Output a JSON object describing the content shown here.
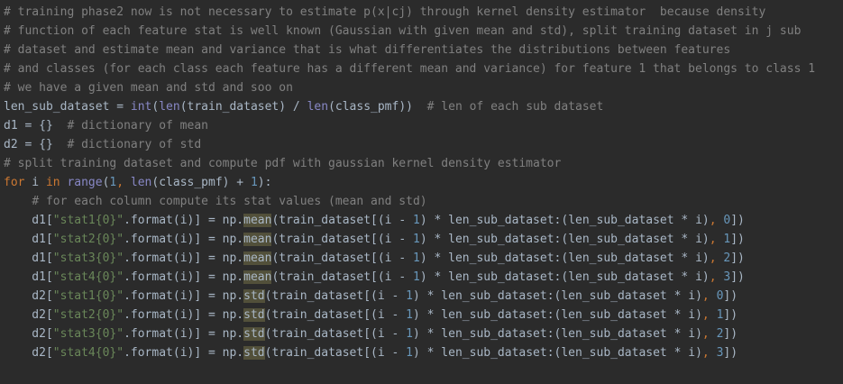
{
  "editor": {
    "theme_colors": {
      "background": "#2b2b2b",
      "default_text": "#a9b7c6",
      "comment": "#808080",
      "keyword": "#cc7832",
      "builtin": "#8888c6",
      "string": "#6a8759",
      "number": "#6897bb",
      "identifier_highlight": "#52503a"
    },
    "lines": [
      [
        {
          "t": "comment",
          "v": "# training phase2 now is not necessary to estimate p(x|cj) through kernel density estimator  because density"
        }
      ],
      [
        {
          "t": "comment",
          "v": "# function of each feature stat is well known (Gaussian with given mean and std), split training dataset in j sub"
        }
      ],
      [
        {
          "t": "comment",
          "v": "# dataset and estimate mean and variance that is what differentiates the distributions between features"
        }
      ],
      [
        {
          "t": "comment",
          "v": "# and classes (for each class each feature has a different mean and variance) for feature 1 that belongs to class 1"
        }
      ],
      [
        {
          "t": "comment",
          "v": "# we have a given mean and std and soo on"
        }
      ],
      [
        {
          "t": "plain",
          "v": "len_sub_dataset = "
        },
        {
          "t": "builtin",
          "v": "int"
        },
        {
          "t": "plain",
          "v": "("
        },
        {
          "t": "builtin",
          "v": "len"
        },
        {
          "t": "plain",
          "v": "(train_dataset) / "
        },
        {
          "t": "builtin",
          "v": "len"
        },
        {
          "t": "plain",
          "v": "(class_pmf))  "
        },
        {
          "t": "comment",
          "v": "# len of each sub dataset"
        }
      ],
      [
        {
          "t": "plain",
          "v": "d1 = {}  "
        },
        {
          "t": "comment",
          "v": "# dictionary of mean"
        }
      ],
      [
        {
          "t": "plain",
          "v": "d2 = {}  "
        },
        {
          "t": "comment",
          "v": "# dictionary of std"
        }
      ],
      [
        {
          "t": "comment",
          "v": "# split training dataset and compute pdf with gaussian kernel density estimator"
        }
      ],
      [
        {
          "t": "keyword",
          "v": "for"
        },
        {
          "t": "plain",
          "v": " i "
        },
        {
          "t": "keyword",
          "v": "in"
        },
        {
          "t": "plain",
          "v": " "
        },
        {
          "t": "builtin",
          "v": "range"
        },
        {
          "t": "plain",
          "v": "("
        },
        {
          "t": "number",
          "v": "1"
        },
        {
          "t": "keyword",
          "v": ","
        },
        {
          "t": "plain",
          "v": " "
        },
        {
          "t": "builtin",
          "v": "len"
        },
        {
          "t": "plain",
          "v": "(class_pmf) + "
        },
        {
          "t": "number",
          "v": "1"
        },
        {
          "t": "plain",
          "v": "):"
        }
      ],
      [
        {
          "t": "plain",
          "v": "    "
        },
        {
          "t": "comment",
          "v": "# for each column compute its stat values (mean and std)"
        }
      ],
      [
        {
          "t": "plain",
          "v": "    d1["
        },
        {
          "t": "string",
          "v": "\"stat1{0}\""
        },
        {
          "t": "plain",
          "v": ".format(i)] = np."
        },
        {
          "t": "hl",
          "v": "mean"
        },
        {
          "t": "plain",
          "v": "(train_dataset[(i - "
        },
        {
          "t": "number",
          "v": "1"
        },
        {
          "t": "plain",
          "v": ") * len_sub_dataset:(len_sub_dataset * i)"
        },
        {
          "t": "keyword",
          "v": ","
        },
        {
          "t": "plain",
          "v": " "
        },
        {
          "t": "number",
          "v": "0"
        },
        {
          "t": "plain",
          "v": "])"
        }
      ],
      [
        {
          "t": "plain",
          "v": "    d1["
        },
        {
          "t": "string",
          "v": "\"stat2{0}\""
        },
        {
          "t": "plain",
          "v": ".format(i)] = np."
        },
        {
          "t": "hl",
          "v": "mean"
        },
        {
          "t": "plain",
          "v": "(train_dataset[(i - "
        },
        {
          "t": "number",
          "v": "1"
        },
        {
          "t": "plain",
          "v": ") * len_sub_dataset:(len_sub_dataset * i)"
        },
        {
          "t": "keyword",
          "v": ","
        },
        {
          "t": "plain",
          "v": " "
        },
        {
          "t": "number",
          "v": "1"
        },
        {
          "t": "plain",
          "v": "])"
        }
      ],
      [
        {
          "t": "plain",
          "v": "    d1["
        },
        {
          "t": "string",
          "v": "\"stat3{0}\""
        },
        {
          "t": "plain",
          "v": ".format(i)] = np."
        },
        {
          "t": "hl",
          "v": "mean"
        },
        {
          "t": "plain",
          "v": "(train_dataset[(i - "
        },
        {
          "t": "number",
          "v": "1"
        },
        {
          "t": "plain",
          "v": ") * len_sub_dataset:(len_sub_dataset * i)"
        },
        {
          "t": "keyword",
          "v": ","
        },
        {
          "t": "plain",
          "v": " "
        },
        {
          "t": "number",
          "v": "2"
        },
        {
          "t": "plain",
          "v": "])"
        }
      ],
      [
        {
          "t": "plain",
          "v": "    d1["
        },
        {
          "t": "string",
          "v": "\"stat4{0}\""
        },
        {
          "t": "plain",
          "v": ".format(i)] = np."
        },
        {
          "t": "hl",
          "v": "mean"
        },
        {
          "t": "plain",
          "v": "(train_dataset[(i - "
        },
        {
          "t": "number",
          "v": "1"
        },
        {
          "t": "plain",
          "v": ") * len_sub_dataset:(len_sub_dataset * i)"
        },
        {
          "t": "keyword",
          "v": ","
        },
        {
          "t": "plain",
          "v": " "
        },
        {
          "t": "number",
          "v": "3"
        },
        {
          "t": "plain",
          "v": "])"
        }
      ],
      [
        {
          "t": "plain",
          "v": "    d2["
        },
        {
          "t": "string",
          "v": "\"stat1{0}\""
        },
        {
          "t": "plain",
          "v": ".format(i)] = np."
        },
        {
          "t": "hl",
          "v": "std"
        },
        {
          "t": "plain",
          "v": "(train_dataset[(i - "
        },
        {
          "t": "number",
          "v": "1"
        },
        {
          "t": "plain",
          "v": ") * len_sub_dataset:(len_sub_dataset * i)"
        },
        {
          "t": "keyword",
          "v": ","
        },
        {
          "t": "plain",
          "v": " "
        },
        {
          "t": "number",
          "v": "0"
        },
        {
          "t": "plain",
          "v": "])"
        }
      ],
      [
        {
          "t": "plain",
          "v": "    d2["
        },
        {
          "t": "string",
          "v": "\"stat2{0}\""
        },
        {
          "t": "plain",
          "v": ".format(i)] = np."
        },
        {
          "t": "hl",
          "v": "std"
        },
        {
          "t": "plain",
          "v": "(train_dataset[(i - "
        },
        {
          "t": "number",
          "v": "1"
        },
        {
          "t": "plain",
          "v": ") * len_sub_dataset:(len_sub_dataset * i)"
        },
        {
          "t": "keyword",
          "v": ","
        },
        {
          "t": "plain",
          "v": " "
        },
        {
          "t": "number",
          "v": "1"
        },
        {
          "t": "plain",
          "v": "])"
        }
      ],
      [
        {
          "t": "plain",
          "v": "    d2["
        },
        {
          "t": "string",
          "v": "\"stat3{0}\""
        },
        {
          "t": "plain",
          "v": ".format(i)] = np."
        },
        {
          "t": "hl",
          "v": "std"
        },
        {
          "t": "plain",
          "v": "(train_dataset[(i - "
        },
        {
          "t": "number",
          "v": "1"
        },
        {
          "t": "plain",
          "v": ") * len_sub_dataset:(len_sub_dataset * i)"
        },
        {
          "t": "keyword",
          "v": ","
        },
        {
          "t": "plain",
          "v": " "
        },
        {
          "t": "number",
          "v": "2"
        },
        {
          "t": "plain",
          "v": "])"
        }
      ],
      [
        {
          "t": "plain",
          "v": "    d2["
        },
        {
          "t": "string",
          "v": "\"stat4{0}\""
        },
        {
          "t": "plain",
          "v": ".format(i)] = np."
        },
        {
          "t": "hl",
          "v": "std"
        },
        {
          "t": "plain",
          "v": "(train_dataset[(i - "
        },
        {
          "t": "number",
          "v": "1"
        },
        {
          "t": "plain",
          "v": ") * len_sub_dataset:(len_sub_dataset * i)"
        },
        {
          "t": "keyword",
          "v": ","
        },
        {
          "t": "plain",
          "v": " "
        },
        {
          "t": "number",
          "v": "3"
        },
        {
          "t": "plain",
          "v": "])"
        }
      ]
    ]
  }
}
